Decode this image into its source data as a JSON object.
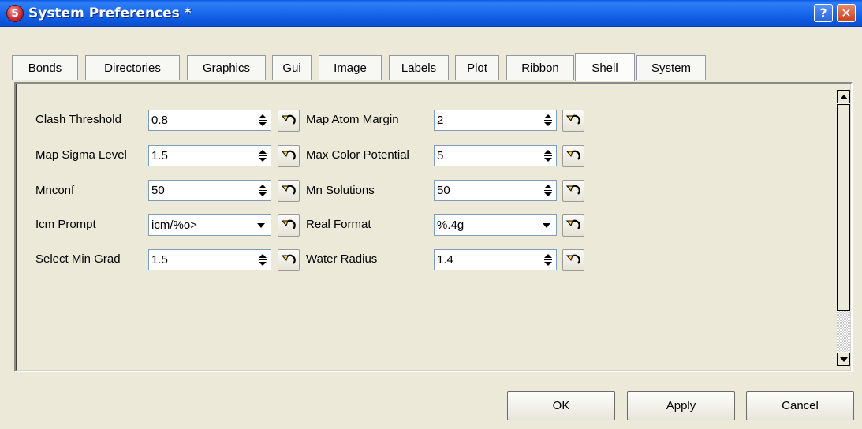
{
  "window": {
    "title": "System Preferences *",
    "logo_glyph": "S",
    "help_label": "?",
    "close_label": "✕"
  },
  "tabs": [
    {
      "label": "Bonds"
    },
    {
      "label": "Directories"
    },
    {
      "label": "Graphics"
    },
    {
      "label": "Gui"
    },
    {
      "label": "Image"
    },
    {
      "label": "Labels"
    },
    {
      "label": "Plot"
    },
    {
      "label": "Ribbon"
    },
    {
      "label": "Shell",
      "active": true
    },
    {
      "label": "System"
    }
  ],
  "fields": {
    "clash_threshold": {
      "label": "Clash Threshold",
      "value": "0.8"
    },
    "map_sigma_level": {
      "label": "Map Sigma Level",
      "value": "1.5"
    },
    "mnconf": {
      "label": "Mnconf",
      "value": "50"
    },
    "icm_prompt": {
      "label": "Icm Prompt",
      "value": "icm/%o>"
    },
    "select_min_grad": {
      "label": "Select Min Grad",
      "value": "1.5"
    },
    "map_atom_margin": {
      "label": "Map Atom Margin",
      "value": "2"
    },
    "max_color_potential": {
      "label": "Max Color Potential",
      "value": "5"
    },
    "mn_solutions": {
      "label": "Mn Solutions",
      "value": "50"
    },
    "real_format": {
      "label": "Real Format",
      "value": "%.4g"
    },
    "water_radius": {
      "label": "Water Radius",
      "value": "1.4"
    }
  },
  "buttons": {
    "ok": "OK",
    "apply": "Apply",
    "cancel": "Cancel"
  },
  "colors": {
    "titlebar": "#0a5ae6",
    "window_bg": "#ece9d8",
    "field_border": "#7f9db9"
  }
}
